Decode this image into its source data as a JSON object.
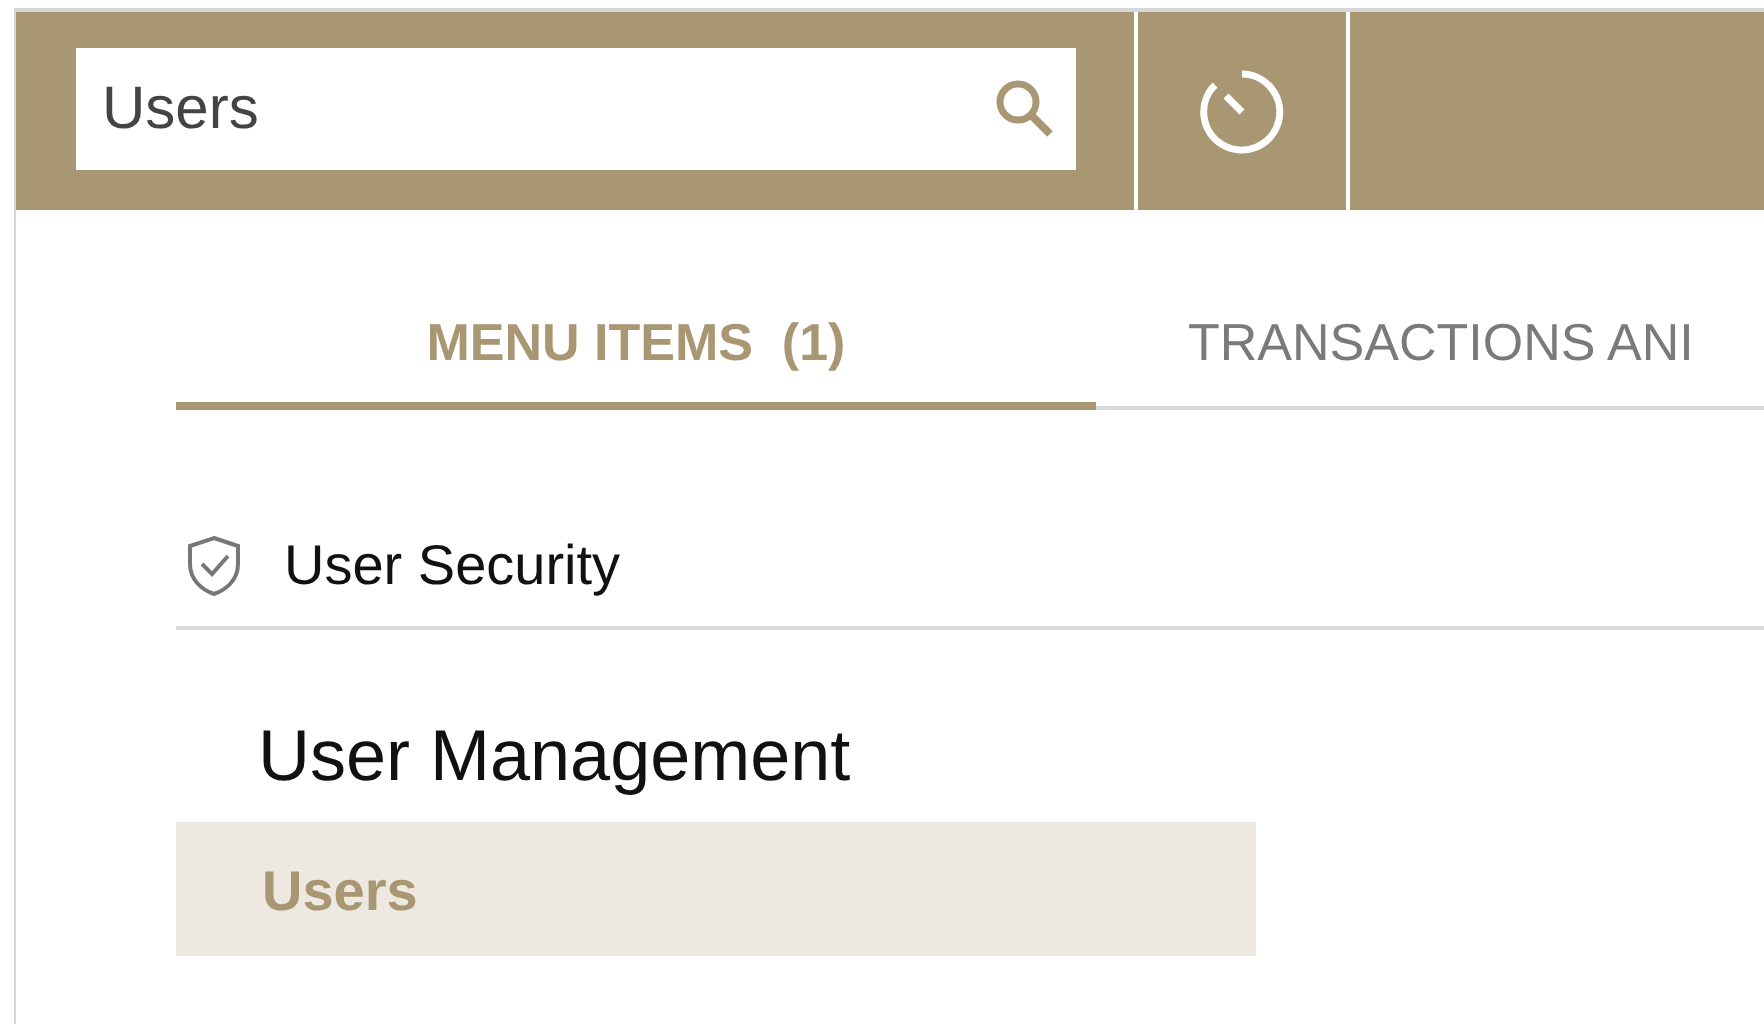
{
  "search": {
    "value": "Users"
  },
  "tabs": [
    {
      "label": "MENU ITEMS  (1)",
      "selected": true
    },
    {
      "label": "TRANSACTIONS ANI",
      "selected": false
    }
  ],
  "groups": [
    {
      "title": "User Security",
      "sections": [
        {
          "title": "User Management",
          "items": [
            {
              "label": "Users",
              "selected": true
            }
          ]
        }
      ]
    }
  ]
}
